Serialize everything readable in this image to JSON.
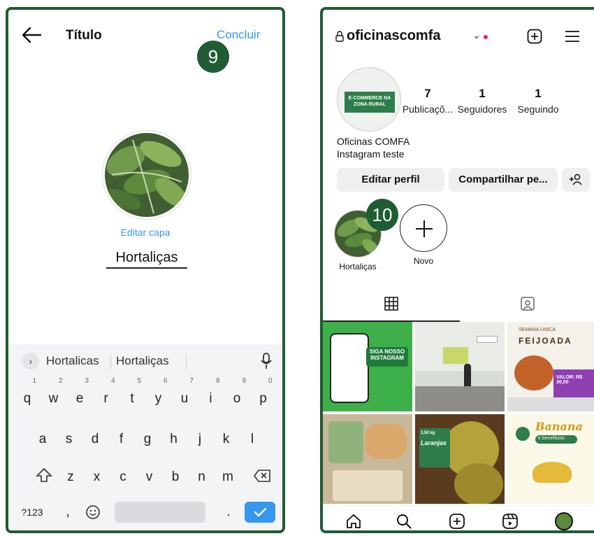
{
  "left": {
    "title": "Título",
    "done_label": "Concluir",
    "badge": "9",
    "edit_cover_label": "Editar capa",
    "highlight_name": "Hortaliças",
    "keyboard": {
      "suggestion_1": "Hortalicas",
      "suggestion_2": "Hortaliças",
      "row1": [
        "q",
        "w",
        "e",
        "r",
        "t",
        "y",
        "u",
        "i",
        "o",
        "p"
      ],
      "row1_hints": [
        "1",
        "2",
        "3",
        "4",
        "5",
        "6",
        "7",
        "8",
        "9",
        "0"
      ],
      "row2": [
        "a",
        "s",
        "d",
        "f",
        "g",
        "h",
        "j",
        "k",
        "l"
      ],
      "row3": [
        "z",
        "x",
        "c",
        "v",
        "b",
        "n",
        "m"
      ],
      "symbols_key": "?123",
      "comma_key": ",",
      "period_key": "."
    }
  },
  "right": {
    "username": "oficinascomfa",
    "avatar_text": "E-COMMERCE NA ZONA RURAL",
    "stats": [
      {
        "value": "7",
        "label": "Publicaçõ..."
      },
      {
        "value": "1",
        "label": "Seguidores"
      },
      {
        "value": "1",
        "label": "Seguindo"
      }
    ],
    "display_name": "Oficinas COMFA",
    "bio": "Instagram teste",
    "edit_profile_label": "Editar perfil",
    "share_profile_label": "Compartilhar pe...",
    "badge": "10",
    "highlights": [
      {
        "label": "Hortaliças"
      },
      {
        "label": "Novo"
      }
    ],
    "posts": {
      "p1_text": "SIGA NOSSO INSTAGRAM",
      "p3_title": "FEIJOADA",
      "p3_sub": "SEMANA ÚNICA",
      "p3_price": "VALOR: R$ 30,00",
      "p5_label": "Laranjas",
      "p5_weight": "3,50 kg",
      "p6_title": "Banana",
      "p6_sub": "e benefícios"
    }
  },
  "colors": {
    "frame_green": "#1f5c33",
    "ig_blue": "#3797f0",
    "brand_green": "#2e7d4a"
  }
}
